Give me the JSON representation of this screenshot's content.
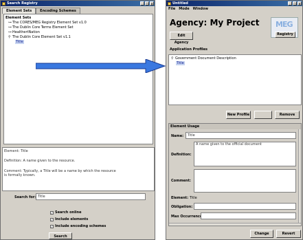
{
  "left_window": {
    "title": "Search Registry",
    "tabs": [
      "Element Sets",
      "Encoding Schemes"
    ],
    "tree": {
      "heading": "Element Sets",
      "items": [
        "The CORES/MEG Registry Element Set v1.0",
        "The Dublin Core Terms Element Set",
        "HealthertNation",
        "The Dublin Core Element Set v1.1"
      ],
      "selected_child": "Title"
    },
    "description": {
      "element": "Element: Title",
      "definition": "Definition: A name given to the resource.",
      "comment_1": "Comment: Typically, a Title will be a name by which the resource",
      "comment_2": "is formally known."
    },
    "search": {
      "label": "Search for:",
      "value": "Title"
    },
    "options": [
      "Search online",
      "Include elements",
      "Include encoding schemes"
    ],
    "search_button": "Search"
  },
  "right_window": {
    "title": "Untitled",
    "menu": [
      "File",
      "Mode",
      "Window"
    ],
    "agency_title": "Agency: My Project",
    "edit_agency_button": "Edit Agency",
    "logo_text": "MEG",
    "registry_button": "Registry",
    "profiles": {
      "heading": "Application Profiles",
      "item": "Government Document Description",
      "child": "Title"
    },
    "new_profile_button": "New Profile",
    "remove_button": "Remove",
    "usage": {
      "heading": "Element Usage",
      "name_label": "Name:",
      "name_value": "Title",
      "definition_label": "Definition:",
      "definition_value": "A name given to the official document",
      "comment_label": "Comment:",
      "element_label": "Element:",
      "element_value": "Title",
      "obligation_label": "Obligation:",
      "max_occ_label": "Max Occurrence:"
    },
    "change_button": "Change",
    "revert_button": "Revert"
  },
  "colors": {
    "titlebar": "#0a246a",
    "arrow_fill": "#3a78e0",
    "selection": "#c6d3f0"
  }
}
